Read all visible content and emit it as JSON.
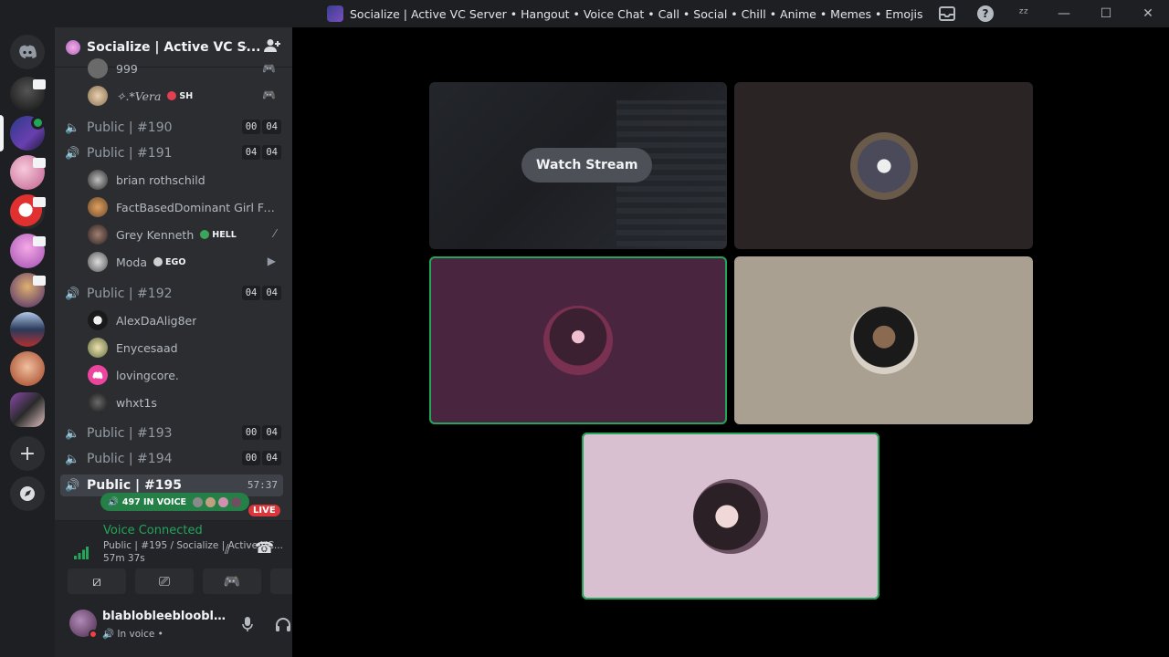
{
  "window": {
    "title": "Socialize | Active VC Server • Hangout • Voice Chat • Call • Social • Chill • Anime • Memes • Emojis",
    "inbox_icon": "inbox-icon",
    "help_icon": "?",
    "updates_icon": "ᶻᶻ",
    "minimize": "—",
    "maximize": "☐",
    "close": "✕"
  },
  "server": {
    "name": "Socialize | Active VC S...",
    "chevron": "⌄",
    "invite_icon": "👤+"
  },
  "channels": [
    {
      "name": "Public | #190",
      "counts": [
        "00",
        "04"
      ]
    },
    {
      "name": "Public | #191",
      "counts": [
        "04",
        "04"
      ]
    },
    {
      "name": "Public | #192",
      "counts": [
        "04",
        "04"
      ]
    },
    {
      "name": "Public | #193",
      "counts": [
        "00",
        "04"
      ]
    },
    {
      "name": "Public | #194",
      "counts": [
        "00",
        "04"
      ]
    },
    {
      "name": "Public | #195",
      "timer": "57:37"
    }
  ],
  "members_top": [
    {
      "name": "999"
    },
    {
      "name": "✧.*Vera",
      "tag": "SH"
    }
  ],
  "members_191": [
    {
      "name": "brian rothschild"
    },
    {
      "name": "FactBasedDominant Girl Fuck..."
    },
    {
      "name": "Grey Kenneth",
      "tag": "HELL"
    },
    {
      "name": "Moda",
      "tag": "EGO"
    }
  ],
  "members_192": [
    {
      "name": "AlexDaAlig8er"
    },
    {
      "name": "Enycesaad"
    },
    {
      "name": "lovingcore."
    },
    {
      "name": "whxt1s"
    }
  ],
  "in_voice_label": "497 IN VOICE",
  "live_label": "LIVE",
  "voice": {
    "status": "Voice Connected",
    "channel": "Public | #195 / Socialize | Active VC...",
    "duration": "57m 37s"
  },
  "user": {
    "name": "blablobleeblooble...",
    "status": "In voice •"
  },
  "stage": {
    "watch_stream": "Watch Stream"
  },
  "colors": {
    "accent_green": "#23a55a",
    "live_red": "#da373c"
  }
}
